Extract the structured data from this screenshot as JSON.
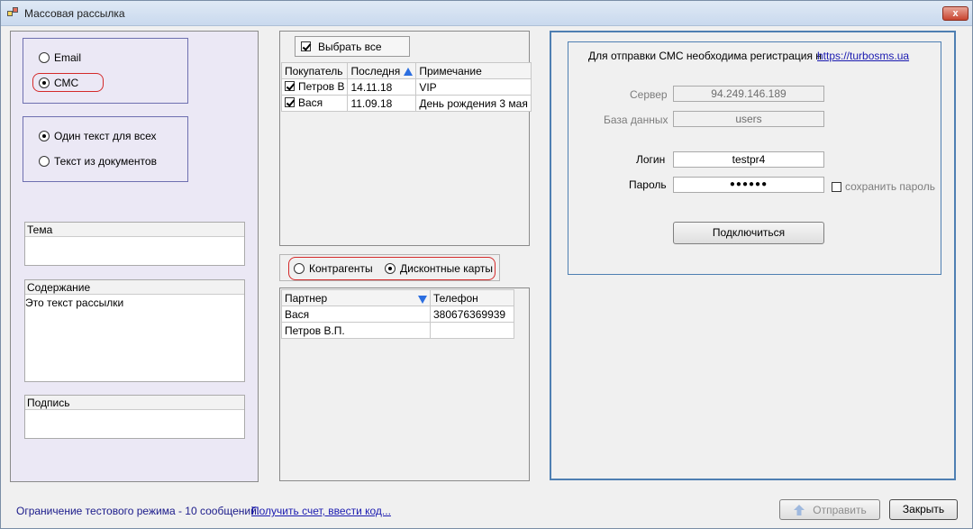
{
  "window": {
    "title": "Массовая рассылка",
    "close_label": "x"
  },
  "left": {
    "mode_email": "Email",
    "mode_sms": "СМС",
    "text_one": "Один текст для всех",
    "text_docs": "Текст из документов",
    "subject_label": "Тема",
    "subject_value": "",
    "content_label": "Содержание",
    "content_value": "Это текст рассылки",
    "signature_label": "Подпись",
    "signature_value": ""
  },
  "buyers": {
    "select_all": "Выбрать все",
    "columns": [
      "Покупатель",
      "Последня",
      "Примечание"
    ],
    "rows": [
      {
        "checked": true,
        "name": "Петров В",
        "date": "14.11.18",
        "note": "VIP"
      },
      {
        "checked": true,
        "name": "Вася",
        "date": "11.09.18",
        "note": "День рождения 3 мая"
      }
    ]
  },
  "source": {
    "contractors": "Контрагенты",
    "cards": "Дисконтные карты"
  },
  "partners": {
    "columns": [
      "Партнер",
      "Телефон"
    ],
    "rows": [
      {
        "name": "Вася",
        "phone": "380676369939"
      },
      {
        "name": "Петров В.П.",
        "phone": ""
      }
    ]
  },
  "sms": {
    "info": "Для отправки СМС необходима регистрация н",
    "url": "https://turbosms.ua",
    "server_label": "Сервер",
    "server_value": "94.249.146.189",
    "db_label": "База данных",
    "db_value": "users",
    "login_label": "Логин",
    "login_value": "testpr4",
    "password_label": "Пароль",
    "password_value": "●●●●●●",
    "save_password": "сохранить пароль",
    "connect": "Подключиться"
  },
  "footer": {
    "limit": "Ограничение тестового режима - 10 сообщений.",
    "get_invoice": "Получить счет, ввести код...",
    "send": "Отправить",
    "close": "Закрыть"
  },
  "colors": {
    "accent_blue": "#4e7fb2",
    "highlight_red": "#d42a2a",
    "left_bg": "#ebe8f5"
  }
}
